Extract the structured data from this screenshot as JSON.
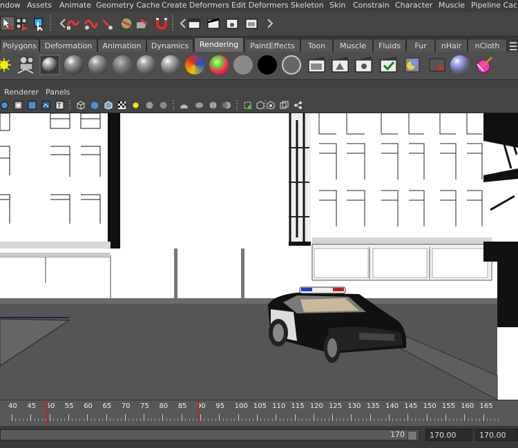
{
  "menubar": {
    "items": [
      "ndow",
      "Assets",
      "Animate",
      "Geometry Cache",
      "Create Deformers",
      "Edit Deformers",
      "Skeleton",
      "Skin",
      "Constrain",
      "Character",
      "Muscle",
      "Pipeline Cache"
    ]
  },
  "shelf_tabs": {
    "items": [
      "Polygons",
      "Deformation",
      "Animation",
      "Dynamics",
      "Rendering",
      "PaintEffects",
      "Toon",
      "Muscle",
      "Fluids",
      "Fur",
      "nHair",
      "nCloth"
    ],
    "active": "Rendering"
  },
  "panel_menu": {
    "items": [
      "Renderer",
      "Panels"
    ]
  },
  "timeline": {
    "labels": [
      "40",
      "45",
      "50",
      "55",
      "60",
      "65",
      "70",
      "75",
      "80",
      "85",
      "90",
      "95",
      "100",
      "105",
      "110",
      "115",
      "120",
      "125",
      "130",
      "135",
      "140",
      "145",
      "150",
      "155",
      "160",
      "165"
    ],
    "start_label": "40",
    "current_frames": [
      "50",
      "90"
    ]
  },
  "range_slider": {
    "end_value": "170",
    "playback_end": "170.00",
    "anim_end": "170.00"
  },
  "colors": {
    "active_tab": "#6a6a6a",
    "menubar": "#3c3c3c",
    "frame_marker": "#c02020"
  },
  "icons": [
    "select-arrow-icon",
    "lasso-icon",
    "paint-select-icon",
    "snap-grid-icon",
    "snap-curve-icon",
    "snap-point-icon",
    "snap-plane-icon",
    "magnet-icon",
    "render-clapper-icon",
    "ipr-render-icon",
    "render-settings-icon",
    "hypershade-icon",
    "light-icon",
    "camera-icon",
    "lambert-icon",
    "blinn-icon",
    "phong-icon",
    "anisotropic-icon",
    "layered-shader-icon",
    "ramp-icon",
    "black-shader-icon",
    "surface-shader-icon",
    "paint-brush-icon"
  ]
}
